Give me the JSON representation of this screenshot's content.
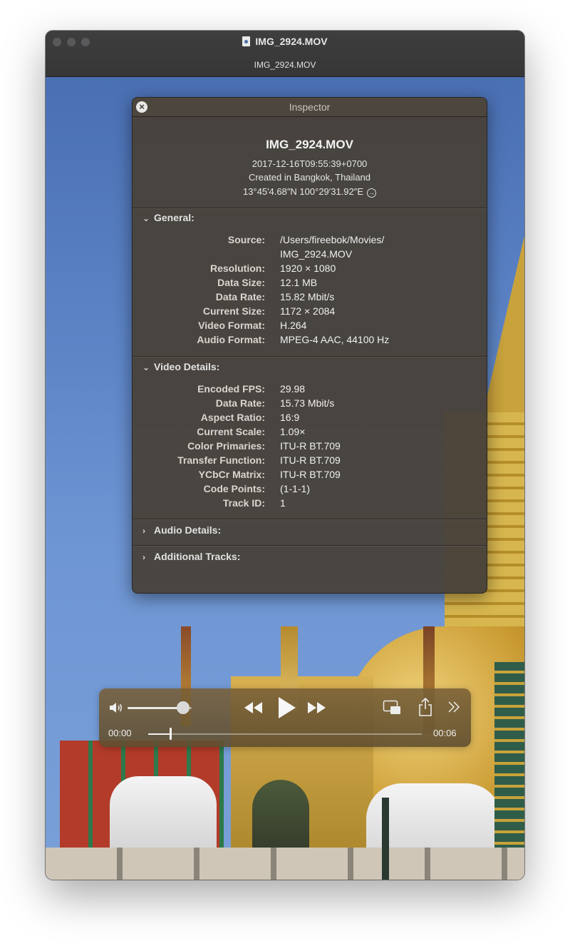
{
  "window": {
    "title": "IMG_2924.MOV",
    "tab_title": "IMG_2924.MOV"
  },
  "inspector": {
    "title": "Inspector",
    "file_name": "IMG_2924.MOV",
    "date": "2017-12-16T09:55:39+0700",
    "created": "Created in Bangkok, Thailand",
    "coordinates": "13°45′4.68″N 100°29′31.92″E",
    "sections": {
      "general": {
        "label": "General:",
        "expanded": true,
        "rows": [
          {
            "key": "Source:",
            "value": "/Users/fireebok/Movies/"
          },
          {
            "key": "",
            "value": "IMG_2924.MOV"
          },
          {
            "key": "Resolution:",
            "value": "1920 × 1080"
          },
          {
            "key": "Data Size:",
            "value": "12.1 MB"
          },
          {
            "key": "Data Rate:",
            "value": "15.82 Mbit/s"
          },
          {
            "key": "Current Size:",
            "value": "1172 × 2084"
          },
          {
            "key": "Video Format:",
            "value": "H.264"
          },
          {
            "key": "Audio Format:",
            "value": "MPEG-4 AAC, 44100 Hz"
          }
        ]
      },
      "video_details": {
        "label": "Video Details:",
        "expanded": true,
        "rows": [
          {
            "key": "Encoded FPS:",
            "value": "29.98"
          },
          {
            "key": "Data Rate:",
            "value": "15.73 Mbit/s"
          },
          {
            "key": "Aspect Ratio:",
            "value": "16:9"
          },
          {
            "key": "Current Scale:",
            "value": "1.09×"
          },
          {
            "key": "Color Primaries:",
            "value": "ITU-R BT.709"
          },
          {
            "key": "Transfer Function:",
            "value": "ITU-R BT.709"
          },
          {
            "key": "YCbCr Matrix:",
            "value": "ITU-R BT.709"
          },
          {
            "key": "Code Points:",
            "value": "(1-1-1)"
          },
          {
            "key": "Track ID:",
            "value": "1"
          }
        ]
      },
      "audio_details": {
        "label": "Audio Details:",
        "expanded": false
      },
      "additional_tracks": {
        "label": "Additional Tracks:",
        "expanded": false
      }
    }
  },
  "controls": {
    "current_time": "00:00",
    "total_time": "00:06",
    "volume_level": 0.85,
    "playback_progress": 0.08
  }
}
